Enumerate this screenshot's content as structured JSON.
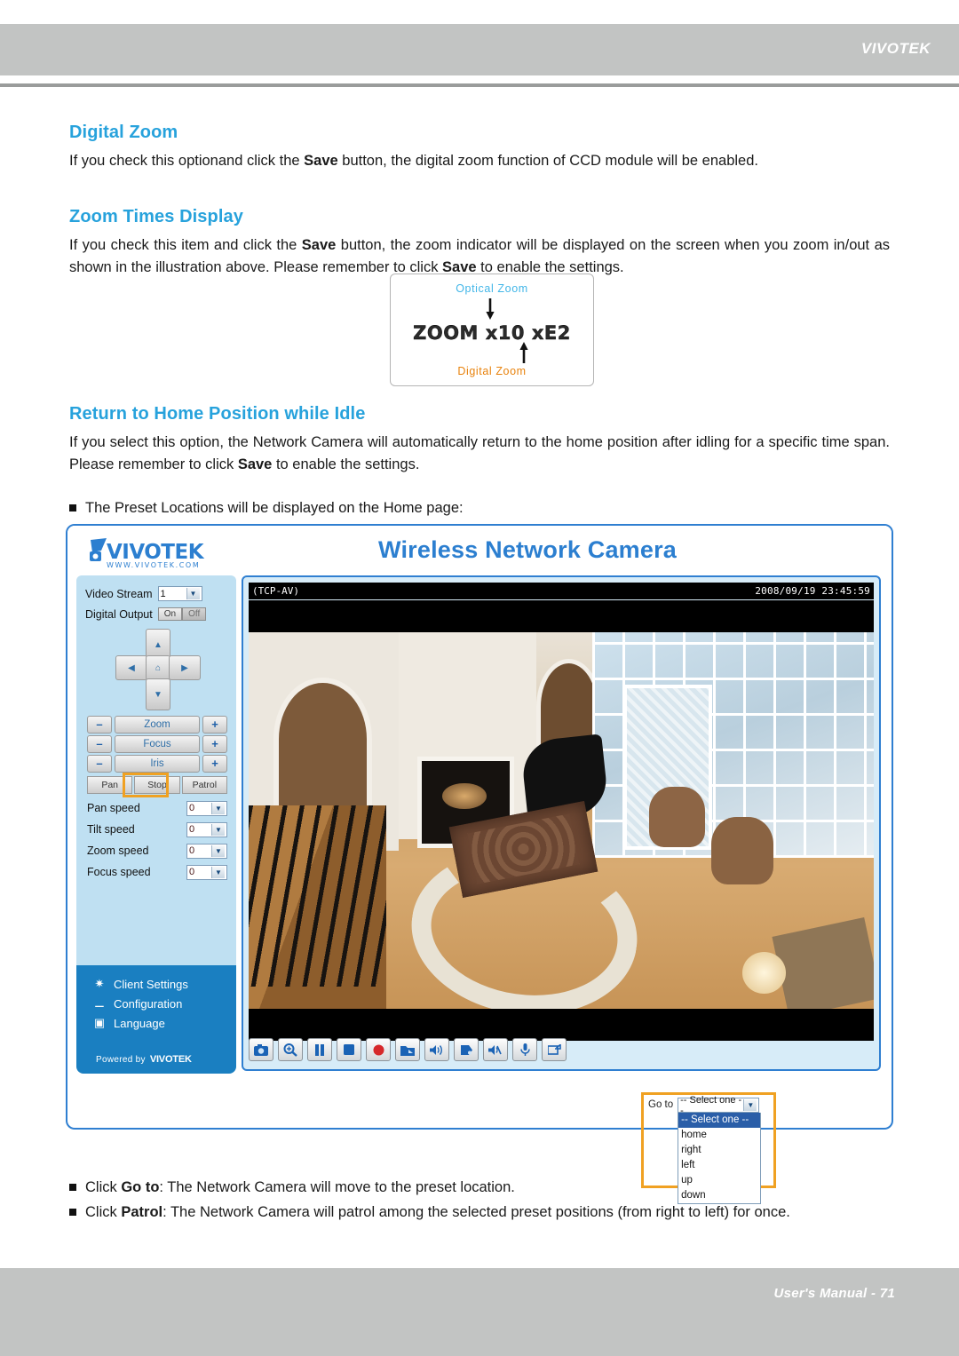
{
  "page": {
    "header_brand": "VIVOTEK",
    "footer": "User's Manual - 71"
  },
  "sections": [
    {
      "heading": "Digital Zoom",
      "body_prefix": "If you check this optionand click the ",
      "body_bold": "Save",
      "body_suffix": " button, the digital zoom function of CCD module will be enabled."
    },
    {
      "heading": "Zoom Times Display",
      "line1_a": "If you check this item and click the ",
      "line1_b": "Save",
      "line1_c": " button, the zoom indicator will be displayed on the screen when you zoom in/out as shown in the illustration above. Please remember to click ",
      "line1_d": "Save",
      "line1_e": " to enable the settings."
    },
    {
      "heading": "Return to Home Position while Idle",
      "line_a": "If you select this option, the Network Camera will automatically return to the home position after idling for a specific time span. Please remember to click ",
      "line_b": "Save",
      "line_c": " to enable the settings."
    }
  ],
  "illustration": {
    "optical_label": "Optical Zoom",
    "digital_label": "Digital Zoom",
    "osd_text": "ZOOM x10 xE2",
    "optical_color": "#42b6e8",
    "digital_color": "#e8820c"
  },
  "bullets": {
    "preset_note": "The Preset Locations will be displayed on the Home page:",
    "goto_a": "Click ",
    "goto_b": "Go to",
    "goto_c": ": The Network Camera will move to the preset location.",
    "patrol_a": "Click ",
    "patrol_b": "Patrol",
    "patrol_c": ": The Network Camera will patrol among the selected preset positions (from right to left) for once."
  },
  "camera_ui": {
    "logo_text": "VIVOTEK",
    "logo_sub": "WWW.VIVOTEK.COM",
    "title": "Wireless Network Camera",
    "osd": {
      "protocol": "(TCP-AV)",
      "timestamp": "2008/09/19 23:45:59"
    },
    "controls": {
      "video_stream_label": "Video Stream",
      "video_stream_value": "1",
      "digital_output_label": "Digital Output",
      "digital_output_on": "On",
      "digital_output_off": "Off",
      "ptz": {
        "up": "up-arrow-icon",
        "down": "down-arrow-icon",
        "left": "left-arrow-icon",
        "right": "right-arrow-icon",
        "home": "home-icon"
      },
      "zoom_label": "Zoom",
      "focus_label": "Focus",
      "iris_label": "Iris",
      "minus": "–",
      "plus": "+",
      "pan_label": "Pan",
      "stop_label": "Stop",
      "patrol_label": "Patrol",
      "speeds": [
        {
          "label": "Pan speed",
          "value": "0"
        },
        {
          "label": "Tilt speed",
          "value": "0"
        },
        {
          "label": "Zoom speed",
          "value": "0"
        },
        {
          "label": "Focus speed",
          "value": "0"
        }
      ]
    },
    "nav": {
      "client_settings": "Client Settings",
      "configuration": "Configuration",
      "language": "Language",
      "powered_by": "Powered by",
      "powered_brand": "VIVOTEK"
    },
    "toolbar": [
      {
        "name": "snapshot-icon",
        "glyph": "▣"
      },
      {
        "name": "digital-zoom-icon",
        "glyph": "⌕"
      },
      {
        "name": "pause-icon",
        "glyph": "❙❙"
      },
      {
        "name": "stop-icon",
        "glyph": "■"
      },
      {
        "name": "record-icon",
        "glyph": "●"
      },
      {
        "name": "storage-folder-icon",
        "glyph": "◢"
      },
      {
        "name": "volume-icon",
        "glyph": "◂"
      },
      {
        "name": "mute-icon",
        "glyph": "▰"
      },
      {
        "name": "talk-icon",
        "glyph": "◣"
      },
      {
        "name": "microphone-icon",
        "glyph": "Ψ"
      },
      {
        "name": "fullscreen-icon",
        "glyph": "❐"
      }
    ],
    "goto": {
      "label": "Go to",
      "selected": "-- Select one --",
      "options": [
        "-- Select one --",
        "home",
        "right",
        "left",
        "up",
        "down"
      ]
    },
    "accent_blue": "#2c7fd0",
    "panel_blue": "#bfe0f2",
    "nav_blue": "#1a7fc1",
    "highlight_orange": "#f0a122"
  }
}
